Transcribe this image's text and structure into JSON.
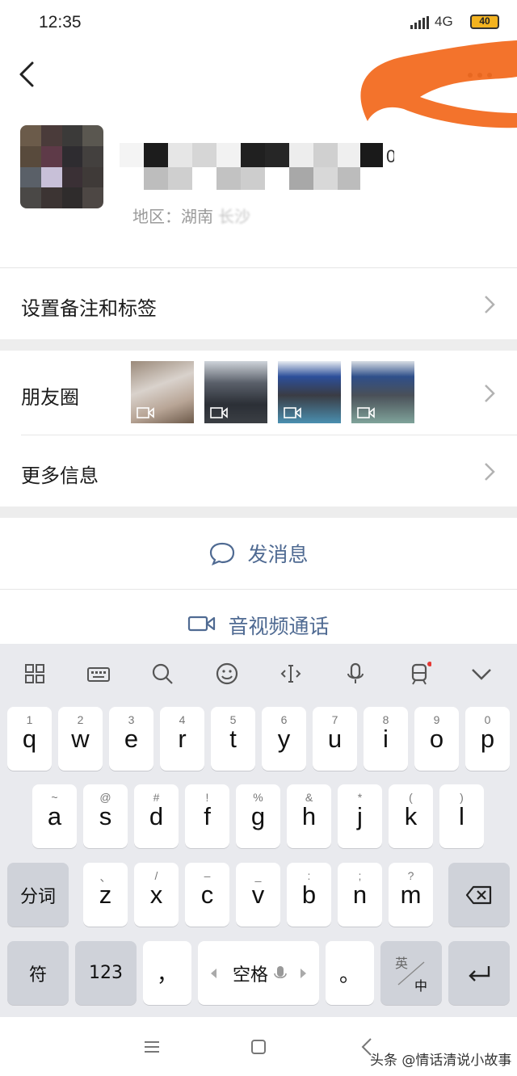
{
  "status_bar": {
    "time": "12:35",
    "network": "4G",
    "battery": "40"
  },
  "profile": {
    "region_label": "地区：湖南",
    "region_city_blurred": "长沙"
  },
  "menu": {
    "remark_tags": "设置备注和标签",
    "moments": "朋友圈",
    "more_info": "更多信息"
  },
  "actions": {
    "send_message": "发消息",
    "av_call": "音视频通话"
  },
  "keyboard": {
    "row1": [
      {
        "sub": "1",
        "key": "q"
      },
      {
        "sub": "2",
        "key": "w"
      },
      {
        "sub": "3",
        "key": "e"
      },
      {
        "sub": "4",
        "key": "r"
      },
      {
        "sub": "5",
        "key": "t"
      },
      {
        "sub": "6",
        "key": "y"
      },
      {
        "sub": "7",
        "key": "u"
      },
      {
        "sub": "8",
        "key": "i"
      },
      {
        "sub": "9",
        "key": "o"
      },
      {
        "sub": "0",
        "key": "p"
      }
    ],
    "row2": [
      {
        "sub": "~",
        "key": "a"
      },
      {
        "sub": "@",
        "key": "s"
      },
      {
        "sub": "#",
        "key": "d"
      },
      {
        "sub": "!",
        "key": "f"
      },
      {
        "sub": "%",
        "key": "g"
      },
      {
        "sub": "&",
        "key": "h"
      },
      {
        "sub": "*",
        "key": "j"
      },
      {
        "sub": "(",
        "key": "k"
      },
      {
        "sub": ")",
        "key": "l"
      }
    ],
    "row3": [
      {
        "sub": "、",
        "key": "z"
      },
      {
        "sub": "/",
        "key": "x"
      },
      {
        "sub": "–",
        "key": "c"
      },
      {
        "sub": "_",
        "key": "v"
      },
      {
        "sub": ":",
        "key": "b"
      },
      {
        "sub": ";",
        "key": "n"
      },
      {
        "sub": "?",
        "key": "m"
      }
    ],
    "segment_label": "分词",
    "symbol_label": "符",
    "numeric_label": "123",
    "comma_label": "，",
    "space_label": "空格",
    "period_label": "。",
    "lang_top": "英",
    "lang_bottom": "中"
  },
  "watermark": "头条 @情话清说小故事",
  "colors": {
    "accent_link": "#4f6a92",
    "keyboard_bg": "#e9eaee",
    "scribble": "#f26b21"
  }
}
